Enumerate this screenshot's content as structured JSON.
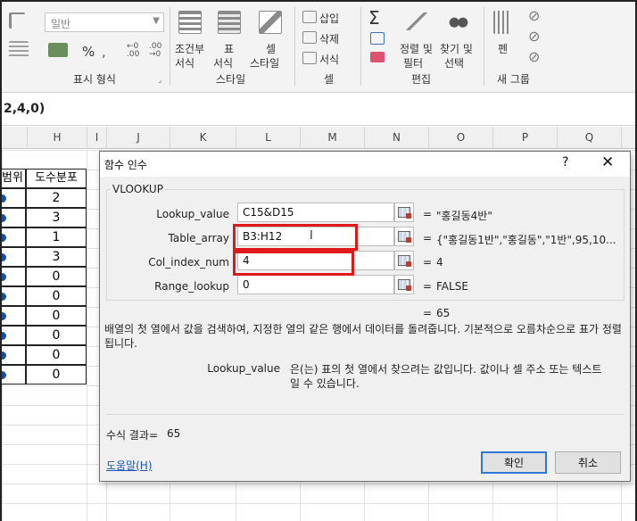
{
  "ribbon": {
    "number_format": {
      "combo_value": "일반",
      "percent": "%",
      "label": "표시 형식"
    },
    "styles": {
      "conditional_format": [
        "조건부",
        "서식"
      ],
      "format_table": [
        "표",
        "서식"
      ],
      "cell_styles": [
        "셀",
        "스타일"
      ],
      "label": "스타일"
    },
    "cells": {
      "insert": "삽입",
      "delete": "삭제",
      "format": "서식",
      "label": "셀"
    },
    "editing": {
      "sort_filter": [
        "정렬 및",
        "필터"
      ],
      "find_select": [
        "찾기 및",
        "선택"
      ],
      "label": "편집"
    },
    "new_group": {
      "pen": "펜",
      "label": "새 그룹"
    }
  },
  "formula_bar": {
    "text": "2,4,0)"
  },
  "columns": [
    "H",
    "I",
    "J",
    "K",
    "L",
    "M",
    "N",
    "O",
    "P",
    "Q"
  ],
  "table": {
    "headers": [
      "범위",
      "도수분포"
    ],
    "freq": [
      "2",
      "3",
      "1",
      "3",
      "0",
      "0",
      "0",
      "0",
      "0",
      "0"
    ]
  },
  "dialog": {
    "title": "함수 인수",
    "help_glyph": "?",
    "close_glyph": "✕",
    "function_name": "VLOOKUP",
    "args": [
      {
        "label": "Lookup_value",
        "value": "C15&D15",
        "eq": "=",
        "result": "\"홍길동4반\""
      },
      {
        "label": "Table_array",
        "value": "B3:H12",
        "eq": "=",
        "result": "{\"홍길동1반\",\"홍길동\",\"1반\",95,10..."
      },
      {
        "label": "Col_index_num",
        "value": "4",
        "eq": "=",
        "result": "4"
      },
      {
        "label": "Range_lookup",
        "value": "0",
        "eq": "=",
        "result": "FALSE"
      }
    ],
    "result_eq": "=",
    "result_value": "65",
    "description": "배열의 첫 열에서 값을 검색하여, 지정한 열의 같은 행에서 데이터를 돌려줍니다. 기본적으로 오름차순으로 표가 정렬됩니다.",
    "arg_help_name": "Lookup_value",
    "arg_help_text": "은(는) 표의 첫 열에서 찾으려는 값입니다. 값이나 셀 주소 또는 텍스트일 수 있습니다.",
    "formula_result_label": "수식 결과=",
    "formula_result_value": "65",
    "help_link": "도움말(H)",
    "ok": "확인",
    "cancel": "취소"
  },
  "colors": {
    "highlight_red": "#e0171b",
    "link_blue": "#1e57b4",
    "ok_border": "#2f78d6"
  }
}
